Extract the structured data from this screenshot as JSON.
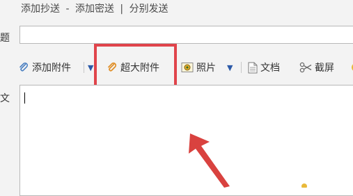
{
  "header_links": {
    "add_cc": "添加抄送",
    "sep1": "-",
    "add_bcc": "添加密送",
    "sep2": "|",
    "separate_send": "分别发送"
  },
  "labels": {
    "subject_partial": "题",
    "body_partial": "文"
  },
  "subject": {
    "value": ""
  },
  "toolbar": {
    "add_attachment": "添加附件",
    "super_attachment": "超大附件",
    "photo": "照片",
    "document": "文档",
    "screenshot": "截屏"
  },
  "editor": {
    "value": ""
  },
  "colors": {
    "highlight": "#e0444b",
    "annotation_arrow": "#d9423f",
    "dropdown": "#2c5aa8"
  },
  "icons": {
    "attachment": "paperclip-icon",
    "super_attachment": "paperclip-orange-icon",
    "photo": "photo-icon",
    "document": "document-icon",
    "screenshot": "scissors-icon"
  }
}
